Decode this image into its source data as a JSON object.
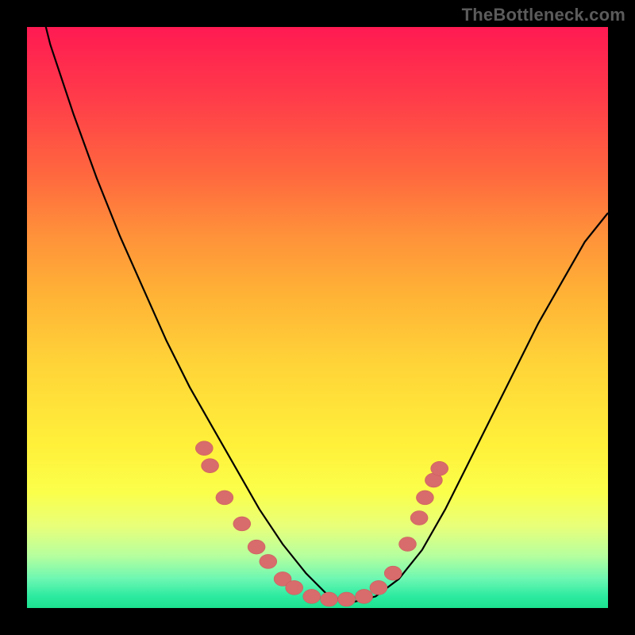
{
  "watermark": "TheBottleneck.com",
  "colors": {
    "frame_bg": "#000000",
    "dot_fill": "#d86b6b",
    "dot_stroke": "#c85a5a",
    "curve_stroke": "#000000",
    "gradient_stops": [
      "#ff1a52",
      "#ff3b4a",
      "#ff6a3e",
      "#ff923a",
      "#ffb236",
      "#ffd438",
      "#fff03a",
      "#fbff4a",
      "#e8ff7a",
      "#b6ff9e",
      "#6cf7b2",
      "#2ceaa0",
      "#1de28f"
    ]
  },
  "chart_data": {
    "type": "line",
    "title": "",
    "xlabel": "",
    "ylabel": "",
    "xlim": [
      0,
      100
    ],
    "ylim": [
      0,
      100
    ],
    "grid": false,
    "legend": false,
    "series": [
      {
        "name": "bottleneck-curve",
        "x": [
          0,
          4,
          8,
          12,
          16,
          20,
          24,
          28,
          32,
          36,
          40,
          44,
          48,
          52,
          56,
          60,
          64,
          68,
          72,
          76,
          80,
          84,
          88,
          92,
          96,
          100
        ],
        "y": [
          113,
          97,
          85,
          74,
          64,
          55,
          46,
          38,
          31,
          24,
          17,
          11,
          6,
          2,
          1,
          2,
          5,
          10,
          17,
          25,
          33,
          41,
          49,
          56,
          63,
          68
        ]
      }
    ],
    "points": [
      {
        "x": 30.5,
        "y": 27.5
      },
      {
        "x": 31.5,
        "y": 24.5
      },
      {
        "x": 34.0,
        "y": 19.0
      },
      {
        "x": 37.0,
        "y": 14.5
      },
      {
        "x": 39.5,
        "y": 10.5
      },
      {
        "x": 41.5,
        "y": 8.0
      },
      {
        "x": 44.0,
        "y": 5.0
      },
      {
        "x": 46.0,
        "y": 3.5
      },
      {
        "x": 49.0,
        "y": 2.0
      },
      {
        "x": 52.0,
        "y": 1.5
      },
      {
        "x": 55.0,
        "y": 1.5
      },
      {
        "x": 58.0,
        "y": 2.0
      },
      {
        "x": 60.5,
        "y": 3.5
      },
      {
        "x": 63.0,
        "y": 6.0
      },
      {
        "x": 65.5,
        "y": 11.0
      },
      {
        "x": 67.5,
        "y": 15.5
      },
      {
        "x": 68.5,
        "y": 19.0
      },
      {
        "x": 70.0,
        "y": 22.0
      },
      {
        "x": 71.0,
        "y": 24.0
      }
    ],
    "annotations": []
  }
}
